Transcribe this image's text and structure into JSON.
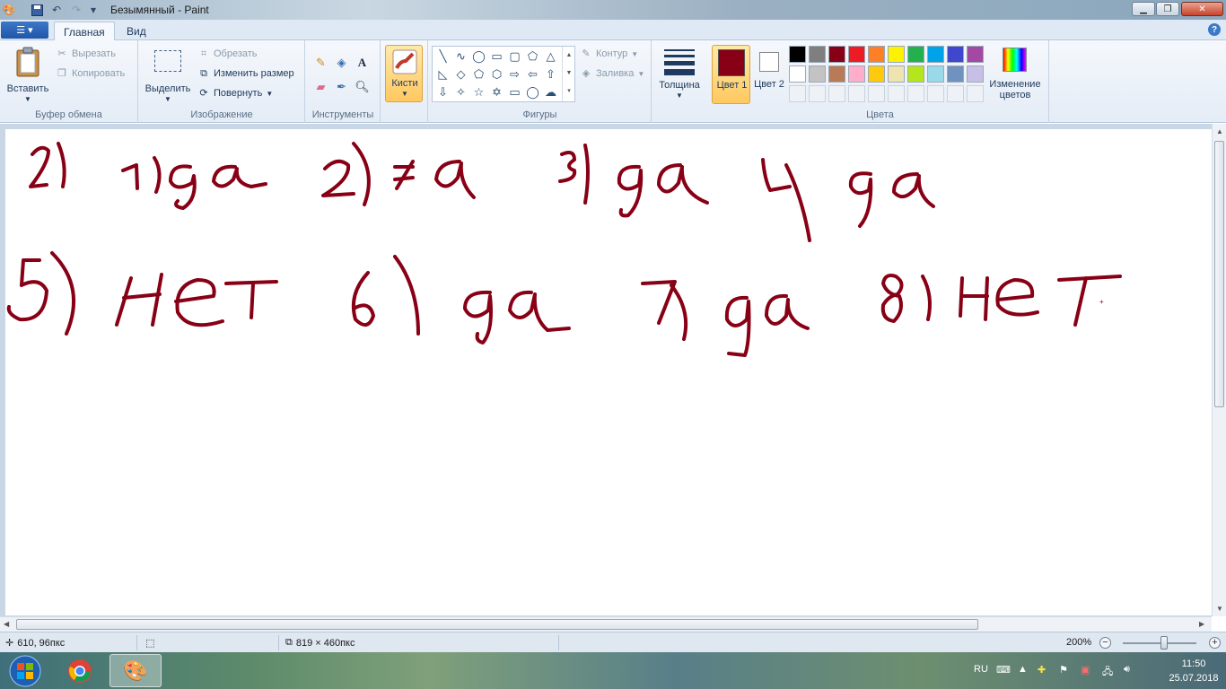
{
  "window": {
    "title": "Безымянный - Paint"
  },
  "menu": {
    "tabs": [
      {
        "label": "Главная"
      },
      {
        "label": "Вид"
      }
    ]
  },
  "ribbon": {
    "clipboard": {
      "label": "Буфер обмена",
      "paste": "Вставить",
      "cut": "Вырезать",
      "copy": "Копировать"
    },
    "image": {
      "label": "Изображение",
      "select": "Выделить",
      "crop": "Обрезать",
      "resize": "Изменить размер",
      "rotate": "Повернуть"
    },
    "tools": {
      "label": "Инструменты"
    },
    "brushes": {
      "label": "Кисти"
    },
    "shapes": {
      "label": "Фигуры",
      "outline": "Контур",
      "fill": "Заливка"
    },
    "size": {
      "label": "Толщина"
    },
    "color1": {
      "label": "Цвет 1",
      "value": "#880015"
    },
    "color2": {
      "label": "Цвет 2",
      "value": "#ffffff"
    },
    "colors": {
      "label": "Цвета",
      "edit": "Изменение цветов",
      "palette_row1": [
        "#000000",
        "#7f7f7f",
        "#880015",
        "#ed1c24",
        "#ff7f27",
        "#fff200",
        "#22b14c",
        "#00a2e8",
        "#3f48cc",
        "#a349a4"
      ],
      "palette_row2": [
        "#ffffff",
        "#c3c3c3",
        "#b97a57",
        "#ffaec9",
        "#ffc90e",
        "#efe4b0",
        "#b5e61d",
        "#99d9ea",
        "#7092be",
        "#c8bfe7"
      ]
    }
  },
  "canvas": {
    "ink_color": "#880015",
    "handwriting": {
      "row1": [
        "2)",
        "1)да",
        "2)≠а",
        "3)да",
        "4)да"
      ],
      "row2": [
        "5)нет",
        "6)да",
        "7)да",
        "8)нет"
      ]
    }
  },
  "status": {
    "cursor": "610, 96пкс",
    "size": "819 × 460пкс",
    "zoom": "200%",
    "zoom_level_percent": 200
  },
  "taskbar": {
    "lang": "RU",
    "time": "11:50",
    "date": "25.07.2018"
  }
}
